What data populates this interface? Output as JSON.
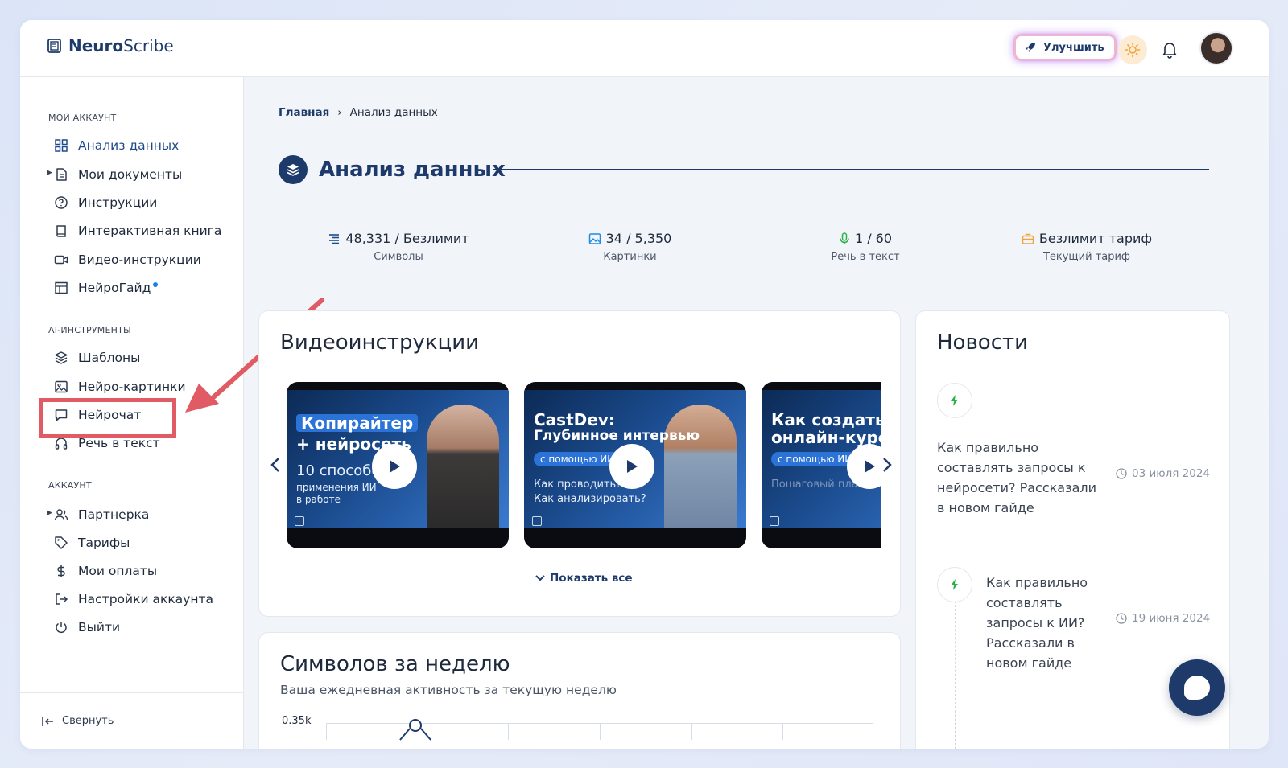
{
  "header": {
    "logo_bold": "Neuro",
    "logo_rest": "Scribe",
    "upgrade_label": "Улучшить"
  },
  "sidebar": {
    "section_account": "МОЙ АККАУНТ",
    "section_ai": "AI-ИНСТРУМЕНТЫ",
    "section_acc2": "АККАУНТ",
    "items": {
      "analysis": "Анализ данных",
      "docs": "Мои документы",
      "instructions": "Инструкции",
      "book": "Интерактивная книга",
      "video": "Видео-инструкции",
      "guide": "НейроГайд",
      "templates": "Шаблоны",
      "images": "Нейро-картинки",
      "chat": "Нейрочат",
      "speech": "Речь в текст",
      "partner": "Партнерка",
      "tariffs": "Тарифы",
      "payments": "Мои оплаты",
      "settings": "Настройки аккаунта",
      "logout": "Выйти"
    },
    "collapse": "Свернуть"
  },
  "breadcrumb": {
    "home": "Главная",
    "sep": "›",
    "current": "Анализ данных"
  },
  "page_title": "Анализ данных",
  "stats": [
    {
      "value": "48,331 / Безлимит",
      "label": "Символы"
    },
    {
      "value": "34 / 5,350",
      "label": "Картинки"
    },
    {
      "value": "1 / 60",
      "label": "Речь в текст"
    },
    {
      "value": "Безлимит тариф",
      "label": "Текущий тариф"
    }
  ],
  "videos": {
    "title": "Видеоинструкции",
    "show_all": "Показать все",
    "items": [
      {
        "line1": "Копирайтер",
        "line2": "+ нейросеть",
        "sub1": "10 способов",
        "sub2": "применения ИИ",
        "sub3": "в работе"
      },
      {
        "line1": "CastDev:",
        "line2": "Глубинное интервью",
        "pill": "с помощью ИИ",
        "sub1": "Как проводить?",
        "sub2": "Как анализировать?"
      },
      {
        "line1": "Как создать",
        "line2": "онлайн-курс",
        "pill": "с помощью ИИ",
        "sub1": "Пошаговый план"
      }
    ]
  },
  "news": {
    "title": "Новости",
    "items": [
      {
        "text": "Как правильно составлять запросы к нейросети? Рассказали в новом гайде",
        "date": "03 июля 2024"
      },
      {
        "text": "Как правильно составлять запросы к ИИ? Рассказали в новом гайде",
        "date": "19 июня 2024"
      }
    ]
  },
  "weekly": {
    "title": "Символов за неделю",
    "subtitle": "Ваша ежедневная активность за текущую неделю",
    "y_tick": "0.35k"
  },
  "colors": {
    "brand": "#1d3a6b",
    "highlight": "#e05b64",
    "bolt": "#2bb14a"
  }
}
